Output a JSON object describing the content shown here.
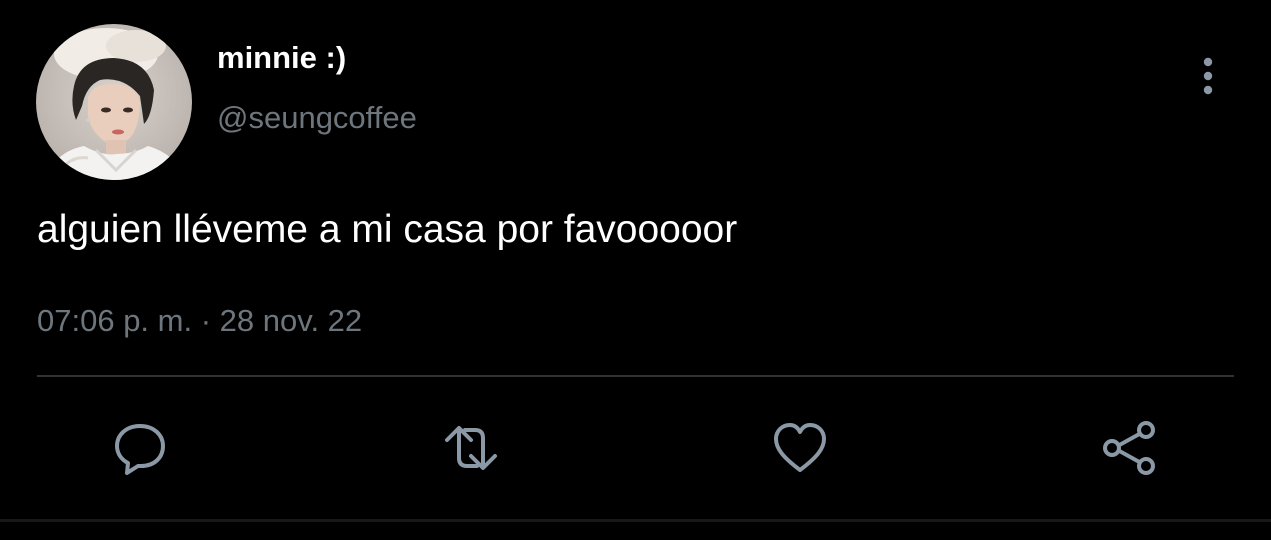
{
  "user": {
    "display_name": "minnie :)",
    "handle": "@seungcoffee",
    "avatar_icon": "profile-photo"
  },
  "tweet": {
    "text": "alguien lléveme a mi casa por favooooor",
    "time": "07:06 p. m.",
    "separator": "·",
    "date": "28 nov. 22"
  },
  "actions": [
    {
      "name": "reply",
      "icon": "speech-bubble-icon"
    },
    {
      "name": "retweet",
      "icon": "retweet-arrows-icon"
    },
    {
      "name": "like",
      "icon": "heart-icon"
    },
    {
      "name": "share",
      "icon": "share-nodes-icon"
    }
  ],
  "colors": {
    "background": "#000000",
    "primary_text": "#ffffff",
    "secondary_text": "#6e767d",
    "icon": "#8b98a5",
    "divider": "#2f3336"
  }
}
